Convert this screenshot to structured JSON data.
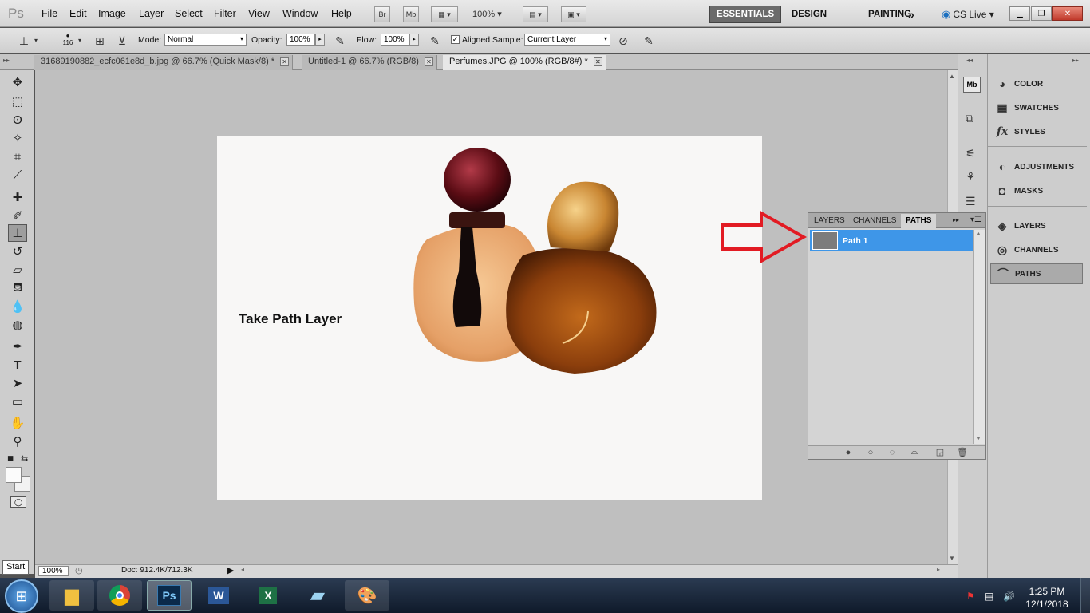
{
  "app": {
    "logo": "Ps"
  },
  "menu": [
    "File",
    "Edit",
    "Image",
    "Layer",
    "Select",
    "Filter",
    "View",
    "Window",
    "Help"
  ],
  "menubar_buttons": {
    "bridge": "Br",
    "mini_bridge": "Mb",
    "zoom": "100%"
  },
  "workspaces": [
    "ESSENTIALS",
    "DESIGN",
    "PAINTING",
    "»"
  ],
  "cs_live": "CS Live",
  "options": {
    "brush_size": "116",
    "mode_label": "Mode:",
    "mode_value": "Normal",
    "opacity_label": "Opacity:",
    "opacity_value": "100%",
    "flow_label": "Flow:",
    "flow_value": "100%",
    "aligned_label": "Aligned",
    "sample_label": "Sample:",
    "sample_value": "Current Layer"
  },
  "tabs": [
    {
      "label": "31689190882_ecfc061e8d_b.jpg @ 66.7% (Quick Mask/8) *"
    },
    {
      "label": "Untitled-1 @ 66.7% (RGB/8)"
    },
    {
      "label": "Perfumes.JPG @ 100% (RGB/8#) *"
    }
  ],
  "canvas": {
    "caption": "Take Path Layer"
  },
  "status": {
    "zoom": "100%",
    "doc": "Doc: 912.4K/712.3K"
  },
  "dock": {
    "group1": [
      "COLOR",
      "SWATCHES",
      "STYLES"
    ],
    "group2": [
      "ADJUSTMENTS",
      "MASKS"
    ],
    "group3": [
      "LAYERS",
      "CHANNELS",
      "PATHS"
    ]
  },
  "paths_panel": {
    "tabs": [
      "LAYERS",
      "CHANNELS",
      "PATHS"
    ],
    "path_name": "Path 1"
  },
  "start_tip": "Start",
  "clock": {
    "time": "1:25 PM",
    "date": "12/1/2018"
  },
  "colors": {
    "arrow": "#e21b23",
    "selection": "#3e96e8",
    "workspace_active": "#6b6b6b"
  }
}
